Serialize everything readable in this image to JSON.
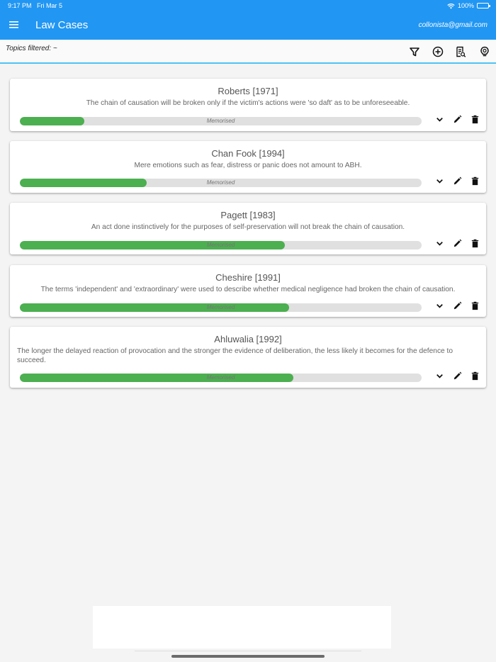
{
  "status_bar": {
    "time": "9:17 PM",
    "date": "Fri Mar 5",
    "battery": "100%"
  },
  "app_bar": {
    "title": "Law Cases",
    "user_email": "collonista@gmail.com"
  },
  "toolbar": {
    "topics_filtered": "Topics filtered: ~",
    "icons": [
      "filter-icon",
      "add-circle-icon",
      "search-document-icon",
      "lightbulb-icon"
    ]
  },
  "accent_colors": {
    "app_bar": "#2196f3",
    "progress_fill": "#4caf50",
    "progress_track": "#e0e0e0"
  },
  "cases": [
    {
      "title": "Roberts [1971]",
      "description": "The chain of causation will be broken only if the victim's actions were 'so daft' as to be unforeseeable.",
      "progress_label": "Memorised",
      "progress": 0.16
    },
    {
      "title": "Chan Fook [1994]",
      "description": "Mere emotions such as fear, distress or panic does not amount to ABH.",
      "progress_label": "Memorised",
      "progress": 0.315
    },
    {
      "title": "Pagett [1983]",
      "description": "An act done instinctively for the purposes of self-preservation will not break the chain of causation.",
      "progress_label": "Memorised",
      "progress": 0.66
    },
    {
      "title": "Cheshire [1991]",
      "description": "The terms 'independent' and 'extraordinary' were used to describe whether medical negligence had broken the chain of causation.",
      "progress_label": "Memorised",
      "progress": 0.67
    },
    {
      "title": "Ahluwalia [1992]",
      "description": "The longer the delayed reaction of provocation and the stronger the evidence of deliberation, the less likely it becomes for the defence to succeed.",
      "progress_label": "Memorised",
      "progress": 0.68
    }
  ]
}
